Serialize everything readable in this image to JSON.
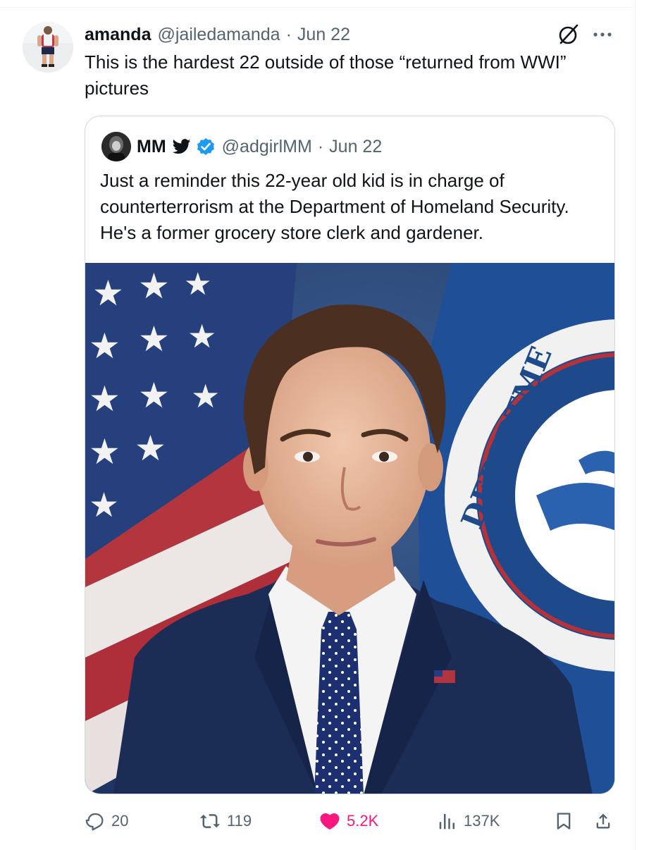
{
  "tweet": {
    "author_name": "amanda",
    "author_handle": "@jailedamanda",
    "separator": "·",
    "date": "Jun 22",
    "text": "This is the hardest 22 outside of those “returned from WWI” pictures"
  },
  "quoted_tweet": {
    "author_name": "MM",
    "author_handle": "@adgirlMM",
    "separator": "·",
    "date": "Jun 22",
    "text": "Just a reminder this 22-year old kid is in charge of counterterrorism at the Department of Homeland Security. He's a former grocery store clerk and gardener.",
    "media": {
      "seal_text": "DEPARTME"
    }
  },
  "actions": {
    "replies": "20",
    "reposts": "119",
    "likes": "5.2K",
    "views": "137K"
  },
  "colors": {
    "text_primary": "#0f1419",
    "text_secondary": "#536471",
    "like_active": "#f91880",
    "verified_blue": "#1d9bf0",
    "border": "#cfd9de"
  },
  "icons": [
    "grok-icon",
    "more-icon",
    "bird-icon",
    "verified-badge-icon",
    "reply-icon",
    "repost-icon",
    "like-icon",
    "views-icon",
    "bookmark-icon",
    "share-icon"
  ]
}
